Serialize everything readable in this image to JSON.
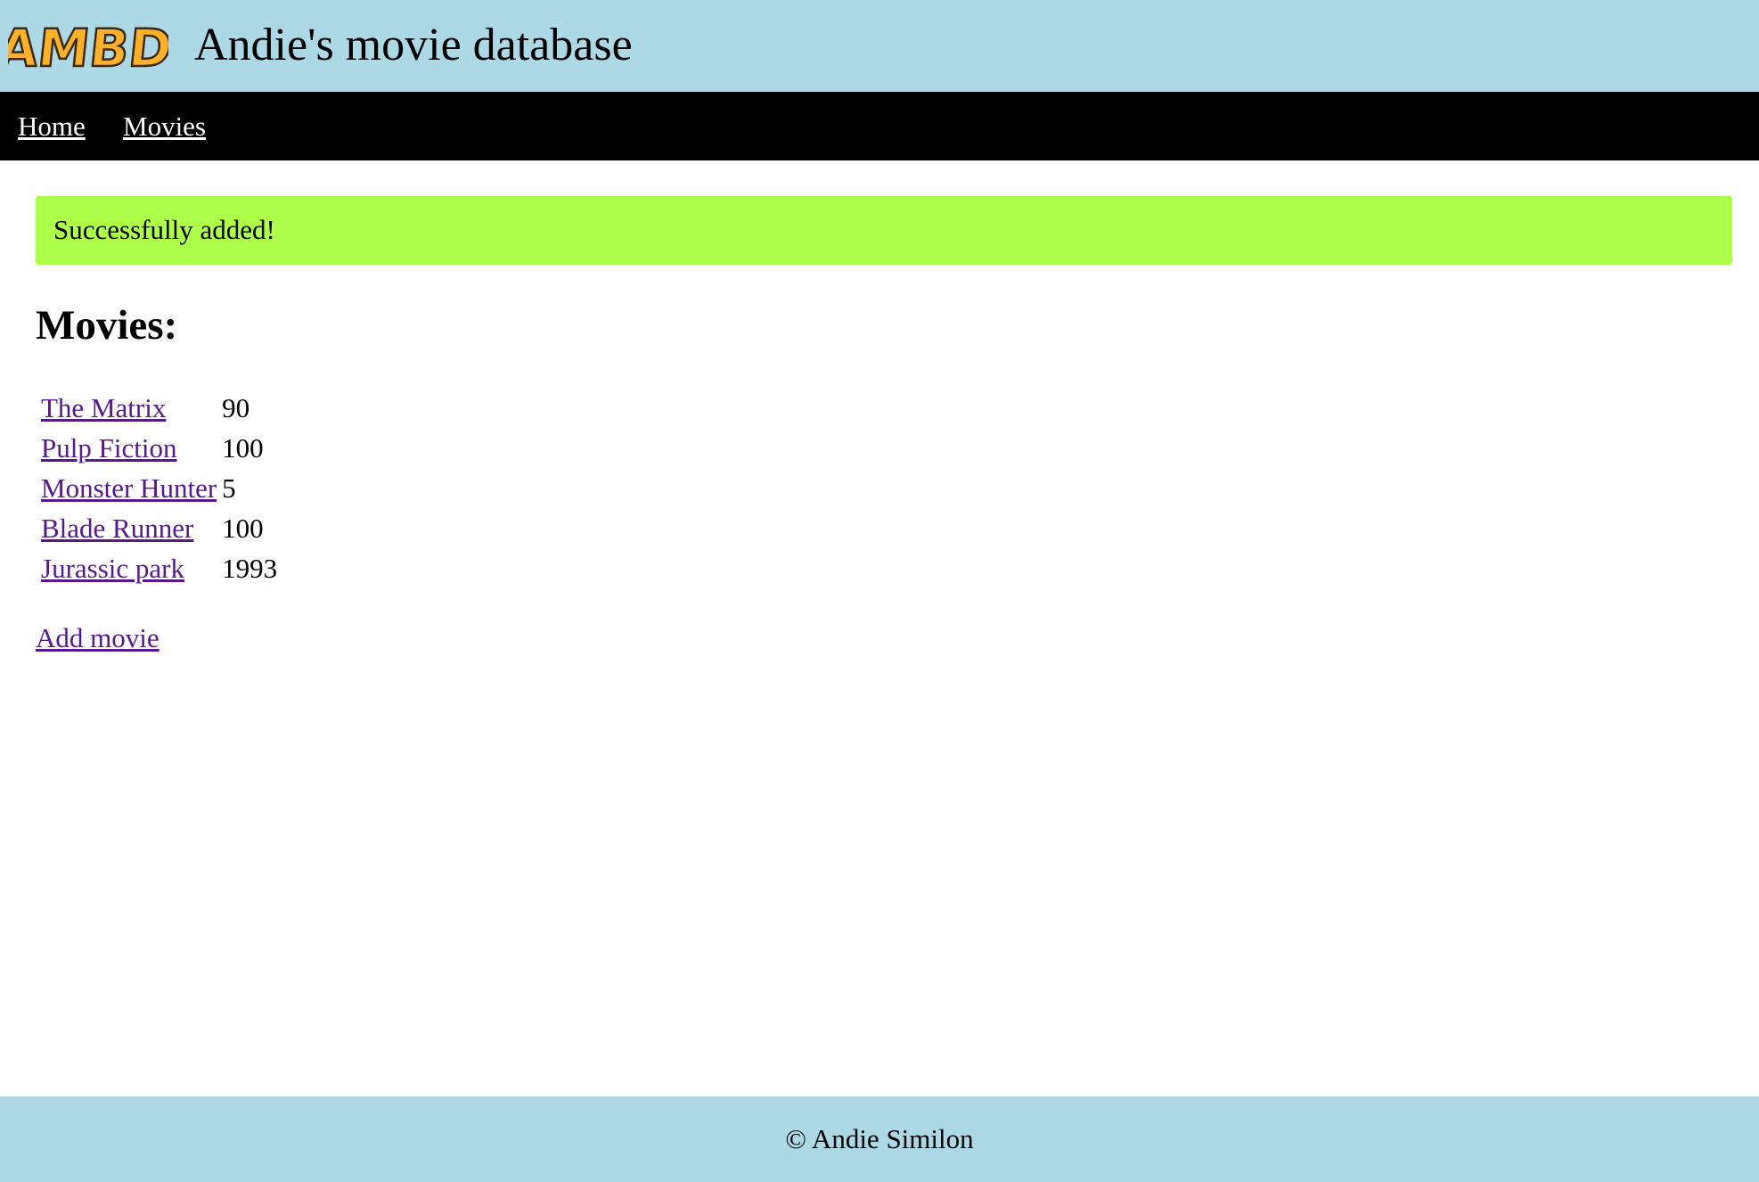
{
  "theme": {
    "header_bg": "#add8e6",
    "nav_bg": "#000000",
    "nav_link_color": "#ffffff",
    "success_bg": "#adff49",
    "visited_link_color": "#551a8b",
    "footer_bg": "#add8e6",
    "logo_fill": "#fdb12b",
    "logo_stroke": "#3a2a10"
  },
  "header": {
    "logo_text": "AMBD",
    "title": "Andie's movie database"
  },
  "nav": {
    "items": [
      {
        "label": "Home"
      },
      {
        "label": "Movies"
      }
    ]
  },
  "flash": {
    "message": "Successfully added!"
  },
  "main": {
    "heading": "Movies:",
    "movies": [
      {
        "title": "The Matrix",
        "value": "90"
      },
      {
        "title": "Pulp Fiction",
        "value": "100"
      },
      {
        "title": "Monster Hunter",
        "value": "5"
      },
      {
        "title": "Blade Runner",
        "value": "100"
      },
      {
        "title": "Jurassic park",
        "value": "1993"
      }
    ],
    "add_label": "Add movie"
  },
  "footer": {
    "text": "© Andie Similon"
  }
}
